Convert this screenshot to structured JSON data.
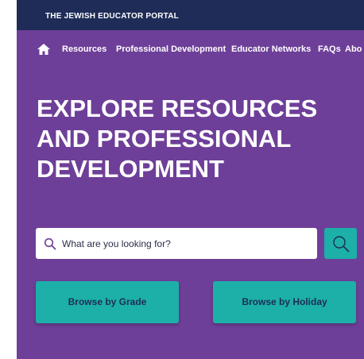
{
  "header": {
    "portal_title": "THE JEWISH EDUCATOR PORTAL"
  },
  "nav": {
    "home_icon": "home-icon",
    "items": [
      {
        "label": "Resources"
      },
      {
        "label": "Professional Development"
      },
      {
        "label": "Educator Networks"
      },
      {
        "label": "FAQs"
      },
      {
        "label": "Abo"
      }
    ]
  },
  "hero": {
    "headline_lines": [
      "EXPLORE RESOURCES",
      "AND PROFESSIONAL",
      "DEVELOPMENT"
    ]
  },
  "search": {
    "placeholder": "What are you looking for?",
    "value": "",
    "icon": "search-icon",
    "button_icon": "search-icon"
  },
  "browse": {
    "grade_label": "Browse by Grade",
    "holiday_label": "Browse by Holiday"
  },
  "colors": {
    "background": "#6e3f98",
    "topbar": "#1e2c57",
    "accent": "#1cb0a8",
    "text_dark": "#1e2c57"
  }
}
